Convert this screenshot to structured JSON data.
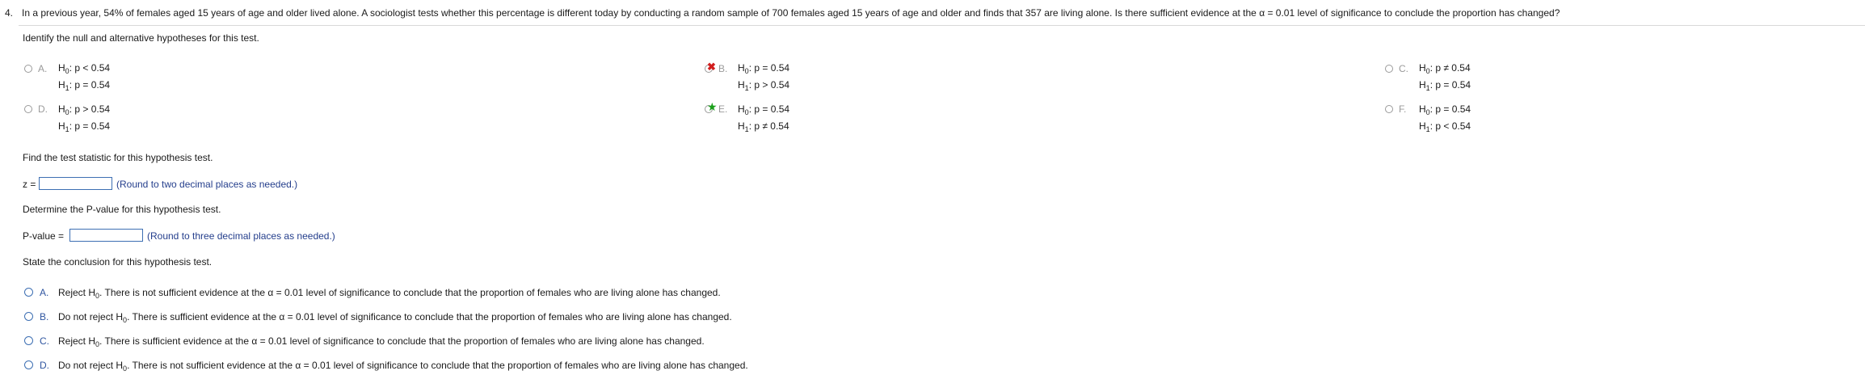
{
  "question": {
    "number": "4.",
    "text": "In a previous year, 54% of females aged 15 years of age and older lived alone. A sociologist tests whether this percentage is different today by conducting a random sample of 700 females aged 15 years of age and older and finds that 357 are living alone. Is there sufficient evidence at the α = 0.01 level of significance to conclude the proportion has changed?"
  },
  "part1": {
    "instruction": "Identify the null and alternative hypotheses for this test.",
    "options": [
      {
        "letter": "A.",
        "h0_op": "p < 0.54",
        "h1_op": "p = 0.54"
      },
      {
        "letter": "B.",
        "h0_op": "p = 0.54",
        "h1_op": "p > 0.54",
        "mark": "✖"
      },
      {
        "letter": "C.",
        "h0_op": "p ≠ 0.54",
        "h1_op": "p = 0.54"
      },
      {
        "letter": "D.",
        "h0_op": "p > 0.54",
        "h1_op": "p = 0.54"
      },
      {
        "letter": "E.",
        "h0_op": "p = 0.54",
        "h1_op": "p ≠ 0.54",
        "mark": "★"
      },
      {
        "letter": "F.",
        "h0_op": "p = 0.54",
        "h1_op": "p < 0.54"
      }
    ],
    "h0_label": "H",
    "h0_sub": "0",
    "h1_sub": "1"
  },
  "part2": {
    "instruction": "Find the test statistic for this hypothesis test.",
    "label": "z =",
    "value": "",
    "hint": "(Round to two decimal places as needed.)"
  },
  "part3": {
    "instruction": "Determine the P-value for this hypothesis test.",
    "label": "P-value =",
    "value": "",
    "hint": "(Round to three decimal places as needed.)"
  },
  "part4": {
    "instruction": "State the conclusion for this hypothesis test.",
    "options": [
      {
        "letter": "A.",
        "pre": "Reject H",
        "post": ". There is not sufficient evidence at the α = 0.01 level of significance to conclude that the proportion of females who are living alone has changed."
      },
      {
        "letter": "B.",
        "pre": "Do not reject H",
        "post": ". There is sufficient evidence at the α = 0.01 level of significance to conclude that the proportion of females who are living alone has changed."
      },
      {
        "letter": "C.",
        "pre": "Reject H",
        "post": ". There is sufficient evidence at the α = 0.01 level of significance to conclude that the proportion of females who are living alone has changed."
      },
      {
        "letter": "D.",
        "pre": "Do not reject H",
        "post": ". There is not sufficient evidence at the α = 0.01 level of significance to conclude that the proportion of females who are living alone has changed."
      }
    ]
  },
  "colors": {
    "link_blue": "#243e8c",
    "wrong_red": "#d21e1e",
    "correct_green": "#1aa01a"
  }
}
